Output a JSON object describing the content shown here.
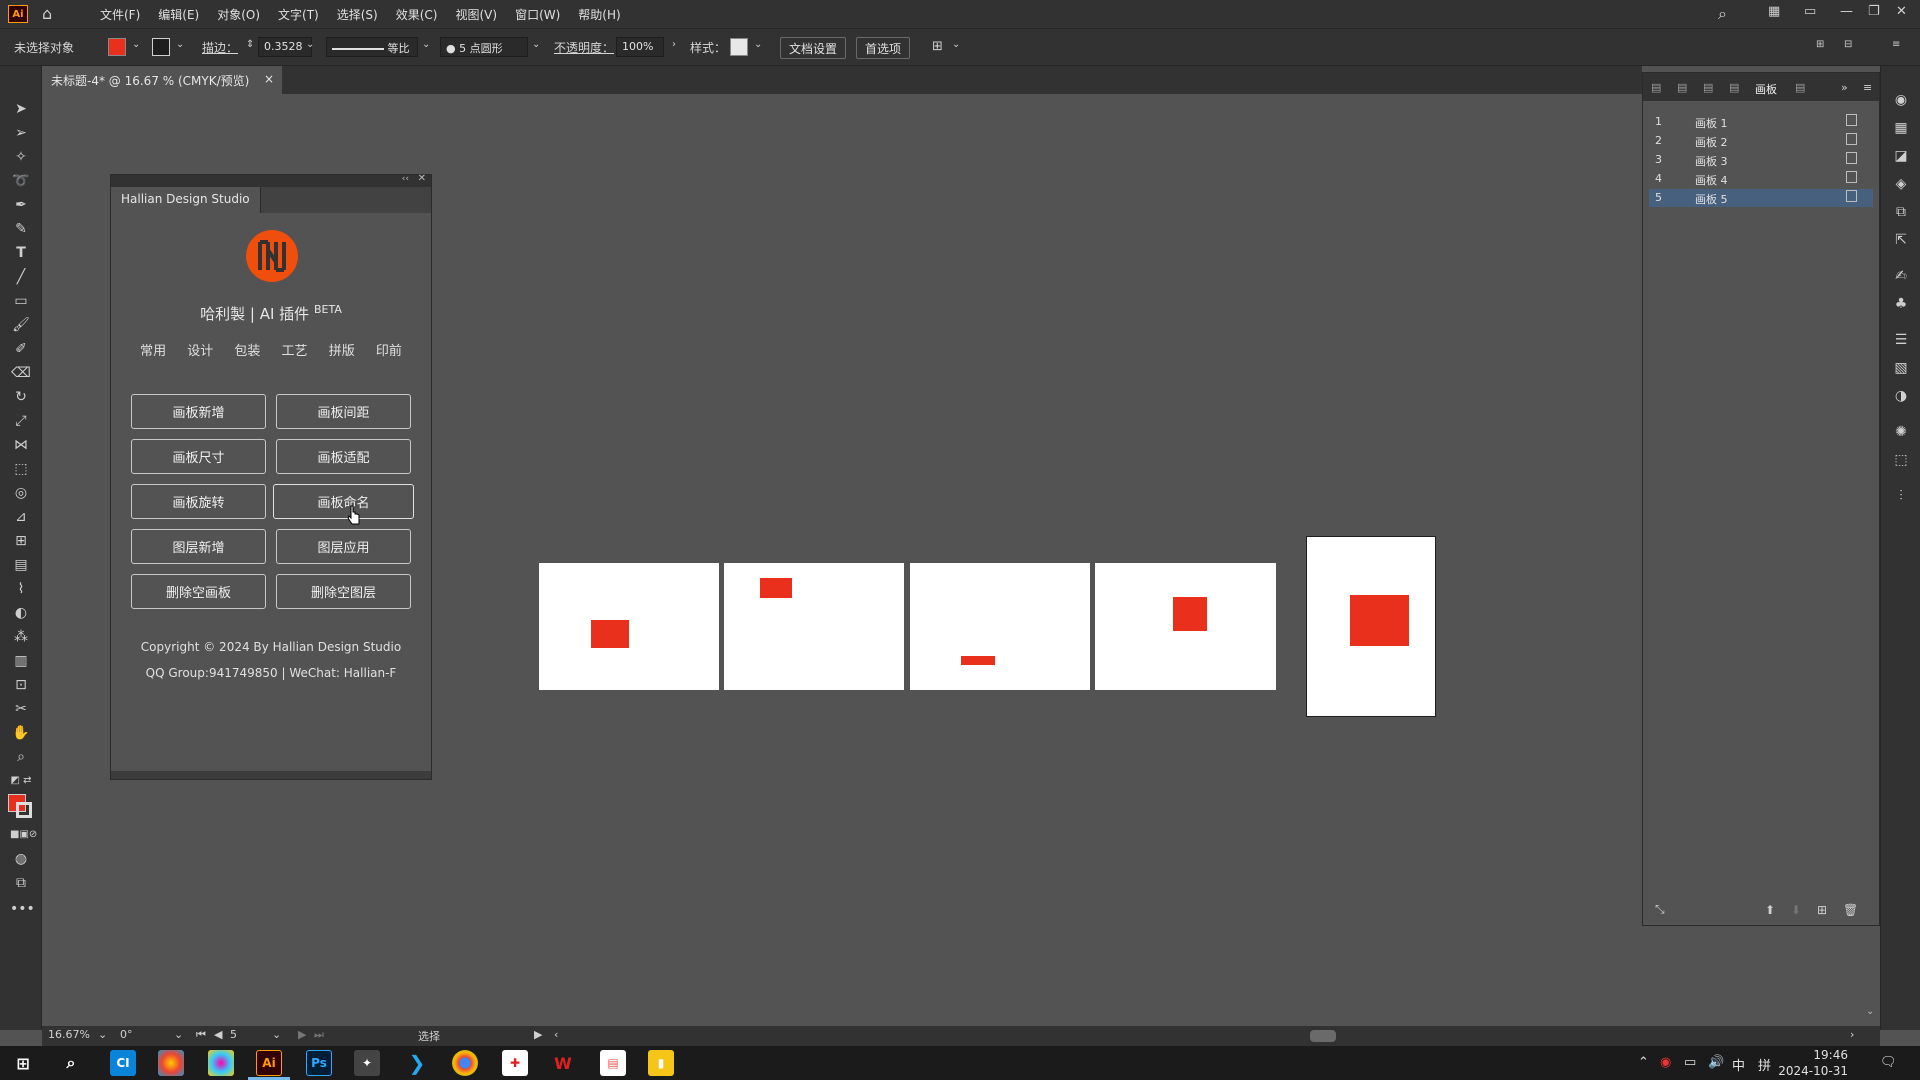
{
  "app": {
    "logo_text": "Ai",
    "menus": [
      "文件(F)",
      "编辑(E)",
      "对象(O)",
      "文字(T)",
      "选择(S)",
      "效果(C)",
      "视图(V)",
      "窗口(W)",
      "帮助(H)"
    ]
  },
  "control": {
    "selection": "未选择对象",
    "stroke_label": "描边：",
    "stroke_value": "0.3528",
    "profile_label": "等比",
    "brush_label": "5 点圆形",
    "opacity_label": "不透明度：",
    "opacity_value": "100%",
    "style_label": "样式：",
    "doc_setup": "文档设置",
    "preferences": "首选项",
    "fill_color": "#e8301c"
  },
  "document": {
    "tab_title": "未标题-4* @ 16.67 % (CMYK/预览)"
  },
  "plugin": {
    "panel_title": "Hallian Design Studio",
    "title": "哈利製 | AI 插件",
    "title_sup": "BETA",
    "categories": [
      "常用",
      "设计",
      "包装",
      "工艺",
      "拼版",
      "印前"
    ],
    "buttons": [
      "画板新增",
      "画板间距",
      "画板尺寸",
      "画板适配",
      "画板旋转",
      "画板命名",
      "图层新增",
      "图层应用",
      "删除空画板",
      "删除空图层"
    ],
    "copyright": "Copyright © 2024 By Hallian Design Studio",
    "contact": "QQ Group:941749850 | WeChat: Hallian-F",
    "brand_color": "#ef4e0c"
  },
  "artboards_panel": {
    "tab_label": "画板",
    "rows": [
      {
        "num": "1",
        "name": "画板 1"
      },
      {
        "num": "2",
        "name": "画板 2"
      },
      {
        "num": "3",
        "name": "画板 3"
      },
      {
        "num": "4",
        "name": "画板 4"
      },
      {
        "num": "5",
        "name": "画板 5"
      }
    ],
    "selected_index": 4
  },
  "status": {
    "zoom": "16.67%",
    "rotation": "0°",
    "artboard_num": "5",
    "tool": "选择"
  },
  "taskbar": {
    "tray_lang": "中",
    "tray_ime": "拼",
    "time": "19:46",
    "date": "2024-10-31"
  }
}
